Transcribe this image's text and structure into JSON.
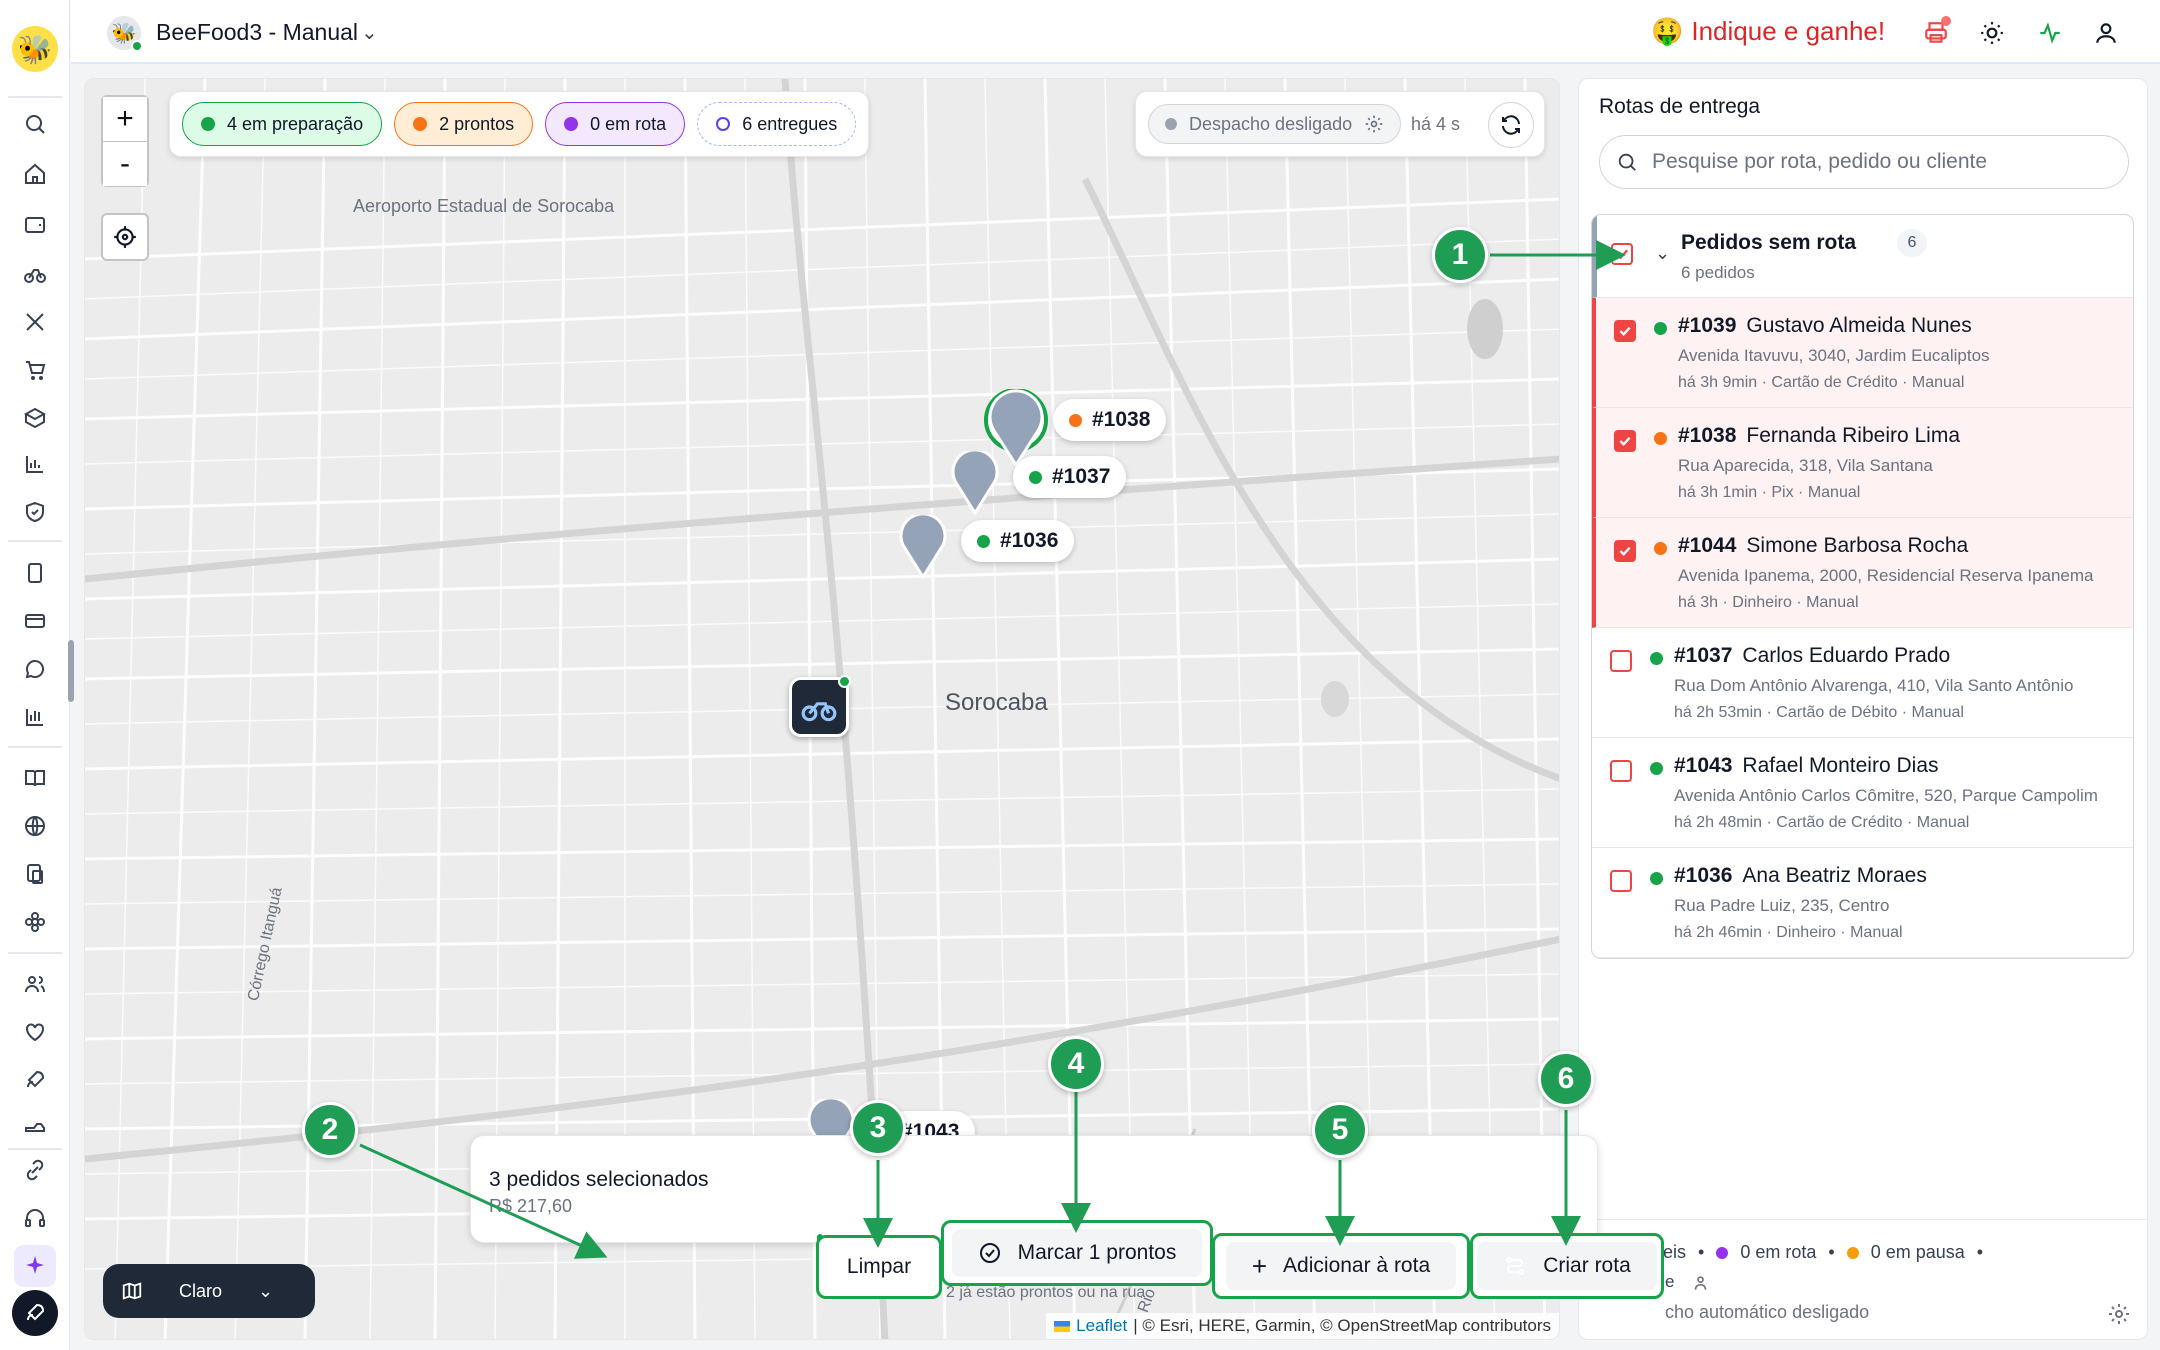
{
  "header": {
    "app_name": "BeeFood3 - Manual",
    "referral": "Indique e ganhe!",
    "icons": [
      "printer-icon",
      "sun-icon",
      "activity-icon",
      "user-icon"
    ]
  },
  "sidebar": {
    "icons": [
      "search-icon",
      "home-icon",
      "wallet-icon",
      "bike-icon",
      "utensils-icon",
      "cart-icon",
      "box-icon",
      "chart-icon",
      "shield-icon",
      "tablet-icon",
      "card-icon",
      "chat-icon",
      "bar-chart-icon",
      "book-icon",
      "globe-icon",
      "devices-icon",
      "settings-flower-icon",
      "users-icon",
      "heart-icon",
      "rocket-icon",
      "delivery-icon",
      "link-icon",
      "headset-icon",
      "sparkles-icon",
      "rocket-icon"
    ]
  },
  "map": {
    "status_pills": [
      {
        "label": "4 em preparação",
        "color": "#16a34a",
        "bg": "#dcfce7",
        "border": "#16a34a"
      },
      {
        "label": "2 prontos",
        "color": "#f97316",
        "bg": "#ffedd5",
        "border": "#f97316"
      },
      {
        "label": "0 em rota",
        "color": "#9333ea",
        "bg": "#f3e8ff",
        "border": "#9333ea"
      },
      {
        "label": "6 entregues",
        "color": "#4f46e5",
        "bg": "#ffffff",
        "border": "#a5b4fc"
      }
    ],
    "dispatch_status": "Despacho desligado",
    "updated_ago": "há 4 s",
    "zoom_in": "+",
    "zoom_out": "-",
    "labels": {
      "airport": "Aeroporto Estadual de Sorocaba",
      "city": "Sorocaba",
      "stream": "Córrego Itanguá",
      "river": "Rio Sorocaba"
    },
    "pins": [
      {
        "label": "#1038",
        "dot": "#f97316"
      },
      {
        "label": "#1037",
        "dot": "#16a34a"
      },
      {
        "label": "#1036",
        "dot": "#16a34a"
      },
      {
        "label": "#1043",
        "dot": ""
      }
    ],
    "theme_label": "Claro",
    "attribution_leaflet": "Leaflet",
    "attribution_rest": "| © Esri, HERE, Garmin, © OpenStreetMap contributors"
  },
  "action_bar": {
    "selected_title": "3 pedidos selecionados",
    "selected_total": "R$ 217,60",
    "clear": "Limpar",
    "mark_ready": "Marcar 1 prontos",
    "mark_ready_hint": "2 já estão prontos ou na rua",
    "add_to_route": "Adicionar à rota",
    "create_route": "Criar rota"
  },
  "callouts": [
    "1",
    "2",
    "3",
    "4",
    "5",
    "6"
  ],
  "panel": {
    "title": "Rotas de entrega",
    "search_placeholder": "Pesquise por rota, pedido ou cliente",
    "group": {
      "title": "Pedidos sem rota",
      "count": "6",
      "subtitle": "6 pedidos"
    },
    "orders": [
      {
        "num": "#1039",
        "name": "Gustavo Almeida Nunes",
        "address": "Avenida Itavuvu, 3040, Jardim Eucaliptos",
        "meta": "há 3h 9min · Cartão de Crédito · Manual",
        "status": "#16a34a",
        "checked": true
      },
      {
        "num": "#1038",
        "name": "Fernanda Ribeiro Lima",
        "address": "Rua Aparecida, 318, Vila Santana",
        "meta": "há 3h 1min · Pix · Manual",
        "status": "#f97316",
        "checked": true
      },
      {
        "num": "#1044",
        "name": "Simone Barbosa Rocha",
        "address": "Avenida Ipanema, 2000, Residencial Reserva Ipanema",
        "meta": "há 3h · Dinheiro · Manual",
        "status": "#f97316",
        "checked": true
      },
      {
        "num": "#1037",
        "name": "Carlos Eduardo Prado",
        "address": "Rua Dom Antônio Alvarenga, 410, Vila Santo Antônio",
        "meta": "há 2h 53min · Cartão de Débito · Manual",
        "status": "#16a34a",
        "checked": false
      },
      {
        "num": "#1043",
        "name": "Rafael Monteiro Dias",
        "address": "Avenida Antônio Carlos Cômitre, 520, Parque Campolim",
        "meta": "há 2h 48min · Cartão de Crédito · Manual",
        "status": "#16a34a",
        "checked": false
      },
      {
        "num": "#1036",
        "name": "Ana Beatriz Moraes",
        "address": "Rua Padre Luiz, 235, Centro",
        "meta": "há 2h 46min · Dinheiro · Manual",
        "status": "#16a34a",
        "checked": false
      }
    ],
    "footer": {
      "available": "níveis",
      "on_route": "0 em rota",
      "paused": "0 em pausa",
      "line2": "e",
      "auto_dispatch": "cho automático desligado"
    }
  }
}
